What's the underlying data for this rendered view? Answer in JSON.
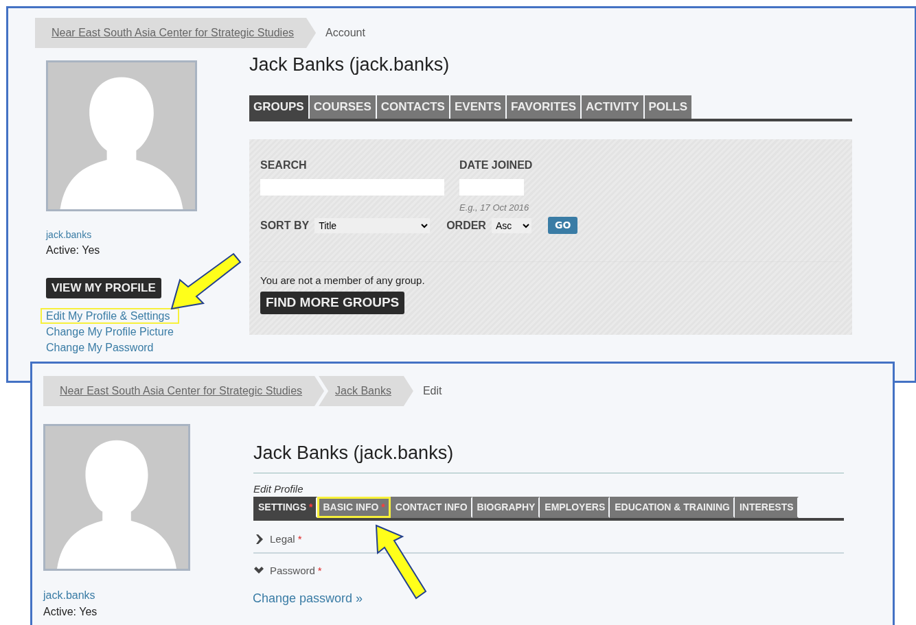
{
  "account_screen": {
    "breadcrumbs": [
      {
        "label": "Near East South Asia Center for Strategic Studies",
        "kind": "link"
      },
      {
        "label": "Account",
        "kind": "current"
      }
    ],
    "profile": {
      "username": "jack.banks",
      "status": "Active: Yes"
    },
    "view_profile_button": "VIEW MY PROFILE",
    "links": [
      {
        "label": "Edit My Profile & Settings",
        "highlighted": true
      },
      {
        "label": "Change My Profile Picture",
        "highlighted": false
      },
      {
        "label": "Change My Password",
        "highlighted": false
      }
    ],
    "title": {
      "name": "Jack Banks (",
      "username": "jack.banks",
      "close": ")"
    },
    "tabs": [
      {
        "label": "GROUPS",
        "selected": true
      },
      {
        "label": "COURSES",
        "selected": false
      },
      {
        "label": "CONTACTS",
        "selected": false
      },
      {
        "label": "EVENTS",
        "selected": false
      },
      {
        "label": "FAVORITES",
        "selected": false
      },
      {
        "label": "ACTIVITY",
        "selected": false
      },
      {
        "label": "POLLS",
        "selected": false
      }
    ],
    "filters": {
      "search_label": "SEARCH",
      "date_label": "DATE JOINED",
      "date_hint": "E.g., 17 Oct 2016",
      "sort_label": "SORT BY",
      "sort_value": "Title",
      "order_label": "ORDER",
      "order_value": "Asc",
      "go_button": "GO"
    },
    "empty_message": "You are not a member of any group.",
    "find_button": "FIND MORE GROUPS"
  },
  "edit_screen": {
    "breadcrumbs": [
      {
        "label": "Near East South Asia Center for Strategic Studies",
        "kind": "link"
      },
      {
        "label": "Jack Banks",
        "kind": "link"
      },
      {
        "label": "Edit",
        "kind": "current"
      }
    ],
    "profile": {
      "username": "jack.banks",
      "status": "Active: Yes"
    },
    "title": {
      "name": "Jack Banks (",
      "username": "jack.banks",
      "close": ")"
    },
    "section_label": "Edit Profile",
    "tabs": [
      {
        "label": "SETTINGS",
        "required_mark": "*",
        "selected": true,
        "highlighted": false
      },
      {
        "label": "BASIC INFO",
        "required_mark": "*",
        "selected": false,
        "highlighted": true
      },
      {
        "label": "CONTACT INFO",
        "selected": false,
        "highlighted": false
      },
      {
        "label": "BIOGRAPHY",
        "selected": false,
        "highlighted": false
      },
      {
        "label": "EMPLOYERS",
        "selected": false,
        "highlighted": false
      },
      {
        "label": "EDUCATION & TRAINING",
        "selected": false,
        "highlighted": false
      },
      {
        "label": "INTERESTS",
        "selected": false,
        "highlighted": false
      }
    ],
    "sections": [
      {
        "label": "Legal",
        "required_mark": "*",
        "expanded": false
      },
      {
        "label": "Password",
        "required_mark": "*",
        "expanded": true
      }
    ],
    "change_password_link": "Change password »"
  }
}
